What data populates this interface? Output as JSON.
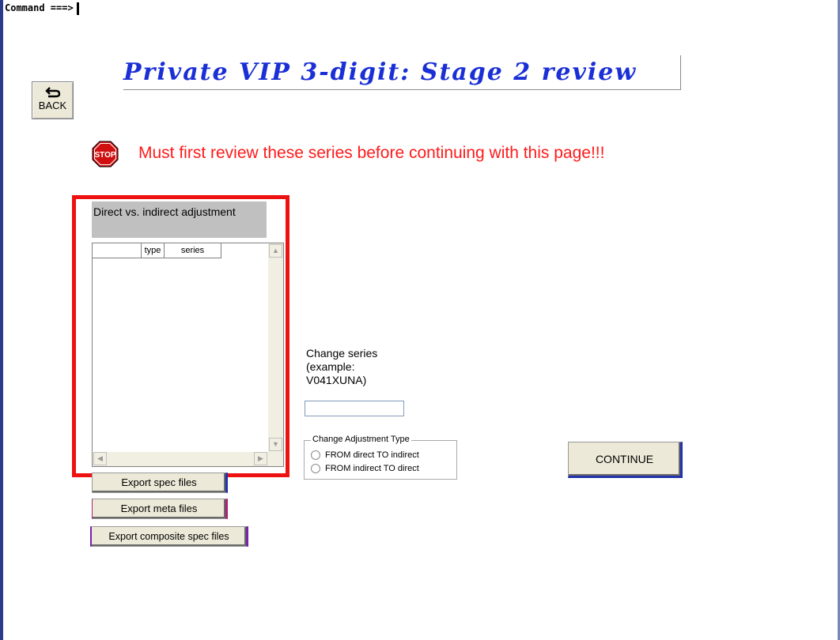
{
  "command_bar": {
    "label": "Command ===>"
  },
  "back_button": {
    "label": "BACK",
    "icon": "back-arrow-icon"
  },
  "title": "Private VIP 3-digit: Stage 2 review",
  "warning": {
    "icon": "stop-sign-icon",
    "icon_text": "STOP",
    "text": "Must first review these series before continuing with this page!!!"
  },
  "adjustment_panel": {
    "header": "Direct vs. indirect adjustment",
    "columns": [
      "",
      "type",
      "series"
    ],
    "rows": []
  },
  "export_buttons": {
    "spec": "Export spec files",
    "meta": "Export meta files",
    "composite": "Export composite spec files"
  },
  "change_series": {
    "label_line1": "Change series",
    "label_line2": "(example:",
    "label_line3": "V041XUNA)",
    "value": ""
  },
  "adjustment_type": {
    "legend": "Change Adjustment Type",
    "options": [
      "FROM direct TO indirect",
      "FROM indirect TO direct"
    ]
  },
  "continue_button": {
    "label": "CONTINUE"
  },
  "colors": {
    "title": "#1a2fd6",
    "warning": "#ff1a1a",
    "highlight": "#ee1111"
  }
}
